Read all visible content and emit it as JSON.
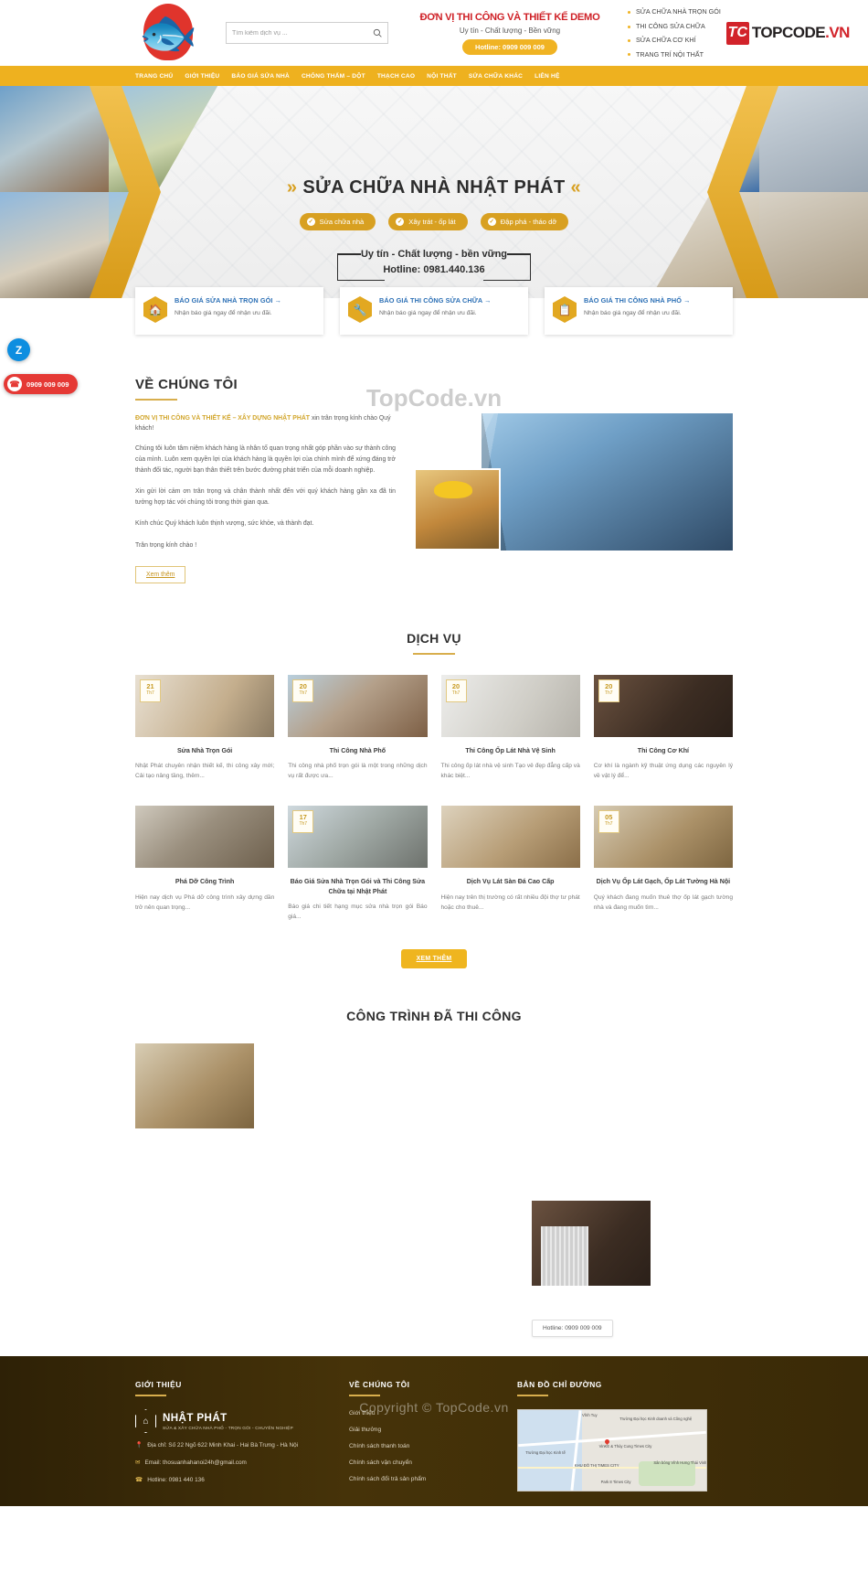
{
  "header": {
    "logo_alt": "koi-fish-logo",
    "search": {
      "placeholder": "Tìm kiếm dịch vụ ..."
    },
    "brand_title": "ĐƠN VỊ THI CÔNG VÀ THIẾT KẾ DEMO",
    "brand_sub": "Uy tín - Chất lượng - Bền vững",
    "hotline_pill": "Hotline: 0909 009 009",
    "bullets": [
      "SỬA CHỮA NHÀ TRỌN GÓI",
      "THI CÔNG SỬA CHỮA",
      "SỬA CHỮA CƠ KHÍ",
      "TRANG TRÍ NỘI THẤT"
    ],
    "topcode": {
      "mark": "TC",
      "name": "TOPCODE",
      "tld": ".VN"
    }
  },
  "nav": {
    "items": [
      "TRANG CHỦ",
      "GIỚI THIỆU",
      "BÁO GIÁ SỬA NHÀ",
      "CHỐNG THẤM – DỘT",
      "THẠCH CAO",
      "NỘI THẤT",
      "SỬA CHỮA KHÁC",
      "LIÊN HỆ"
    ]
  },
  "hero": {
    "arrow_left": "»",
    "arrow_right": "«",
    "title": "SỬA CHỮA NHÀ NHẬT PHÁT",
    "pills": [
      "Sửa chữa nhà",
      "Xây trát - ốp lát",
      "Đập phá - tháo dỡ"
    ],
    "motto_line1": "Uy tín - Chất lượng - bền vững",
    "motto_line2": "Hotline: 0981.440.136"
  },
  "cards3": [
    {
      "icon": "home-icon",
      "title": "BÁO GIÁ SỬA NHÀ TRỌN GÓI →",
      "desc": "Nhận báo giá ngay để nhận ưu đãi."
    },
    {
      "icon": "tools-icon",
      "title": "BÁO GIÁ THI CÔNG SỬA CHỮA →",
      "desc": "Nhận báo giá ngay để nhận ưu đãi."
    },
    {
      "icon": "clipboard-icon",
      "title": "BÁO GIÁ THI CÔNG NHÀ PHỐ →",
      "desc": "Nhận báo giá ngay để nhận ưu đãi."
    }
  ],
  "floating": {
    "zalo_label": "Z",
    "phone_icon": "phone-icon",
    "phone_number": "0909 009 009"
  },
  "about": {
    "heading": "VỀ CHÚNG TÔI",
    "lead_strong": "ĐƠN VỊ THI CÔNG VÀ THIẾT KẾ – XÂY DỰNG NHẬT PHÁT",
    "lead_rest": " xin trân trọng kính chào Quý khách!",
    "p1": "Chúng tôi luôn tâm niệm khách hàng là nhân tố quan trọng nhất góp phần vào sự thành công của mình. Luôn xem quyền lợi của khách hàng là quyền lợi của chính mình để xứng đáng trở thành đối tác, người bạn thân thiết trên bước đường phát triển của mỗi doanh nghiệp.",
    "p2": "Xin gửi lời cảm ơn trân trọng và chân thành nhất đến với quý khách hàng gần xa đã tin tưởng hợp tác với chúng tôi trong thời gian qua.",
    "p3": "Kính chúc Quý khách luôn thịnh vượng, sức khỏe, và thành đạt.",
    "p4": "Trân trọng kính chào !",
    "button": "Xem thêm"
  },
  "services": {
    "heading": "DỊCH VỤ",
    "more_button": "XEM THÊM",
    "items": [
      {
        "day": "21",
        "month": "Th7",
        "title": "Sửa Nhà Trọn Gói",
        "desc": "Nhật Phát chuyên nhận thiết kế, thi công xây mới; Cải tạo nâng tầng, thêm..."
      },
      {
        "day": "20",
        "month": "Th7",
        "title": "Thi Công Nhà Phố",
        "desc": "Thi công nhà phố trọn gói là một trong những dịch vụ rất được ưa..."
      },
      {
        "day": "20",
        "month": "Th7",
        "title": "Thi Công Ốp Lát Nhà Vệ Sinh",
        "desc": "Thi công ốp lát nhà vệ sinh Tạo vẻ đẹp đẳng cấp và khác biệt..."
      },
      {
        "day": "20",
        "month": "Th7",
        "title": "Thi Công Cơ Khí",
        "desc": "Cơ khí là ngành kỹ thuật ứng dụng các nguyên lý về vật lý để..."
      },
      {
        "day": "",
        "month": "",
        "title": "Phá Dỡ Công Trình",
        "desc": "Hiện nay dịch vụ Phá dỡ công trình xây dựng dần trở nên quan trọng..."
      },
      {
        "day": "17",
        "month": "Th7",
        "title": "Báo Giá Sửa Nhà Trọn Gói và Thi Công Sửa Chữa tại Nhật Phát",
        "desc": "Báo giá chi tiết hạng mục sửa nhà trọn gói      Báo giá..."
      },
      {
        "day": "",
        "month": "",
        "title": "Dịch Vụ Lát Sàn Đá Cao Cấp",
        "desc": "Hiện nay trên thị trường có rất nhiều đội thợ tư phát hoặc cho thuê..."
      },
      {
        "day": "05",
        "month": "Th7",
        "title": "Dịch Vụ Ốp Lát Gạch, Ốp Lát Tường Hà Nội",
        "desc": "Quý khách đang muốn thuê thợ ốp lát gạch tường nhà và đang muốn tìm..."
      }
    ]
  },
  "projects": {
    "heading": "CÔNG TRÌNH ĐÃ THI CÔNG",
    "hotline_chip": "Hotline: 0909 009 009",
    "item_labels": [
      "stone-floor-project",
      "gate-project"
    ]
  },
  "footer": {
    "col1": {
      "heading": "GIỚI THIỆU",
      "logo_name": "NHẬT PHÁT",
      "logo_slogan": "SỬA & XÂY CHỮA NHÀ PHỐ - TRỌN GÓI - CHUYÊN NGHIỆP",
      "address": "Địa chỉ: Số 22 Ngõ 622 Minh Khai - Hai Bà Trưng - Hà Nội",
      "email": "Email: thosuanhahanoi24h@gmail.com",
      "hotline": "Hotline: 0981 440 136",
      "icons": [
        "location-icon",
        "mail-icon",
        "phone-icon"
      ]
    },
    "col2": {
      "heading": "VỀ CHÚNG TÔI",
      "links": [
        "Giới thiệu",
        "Giải thưởng",
        "Chính sách thanh toán",
        "Chính sách vận chuyển",
        "Chính sách đổi trả sản phẩm"
      ]
    },
    "col3": {
      "heading": "BẢN ĐỒ CHỈ ĐƯỜNG",
      "map_labels": [
        "Trường Đại học Kinh doanh và Công nghệ",
        "Trường Đại học Kinh tế",
        "VinKE & Thủy Cung Times City",
        "KHU ĐÔ THỊ TIMES CITY",
        "Sân bóng Vĩnh Hưng Thái Vinh",
        "Park 8 Times City",
        "Vĩnh Tuy"
      ]
    },
    "watermark": "Copyright © TopCode.vn"
  },
  "watermarks": {
    "about_overlay": "TopCode.vn"
  },
  "colors": {
    "brand_yellow": "#eeb11f",
    "brand_red": "#cf2127",
    "link_blue": "#2b6fb5",
    "gold": "#d8a021",
    "footer_brown": "#3d2c08"
  }
}
